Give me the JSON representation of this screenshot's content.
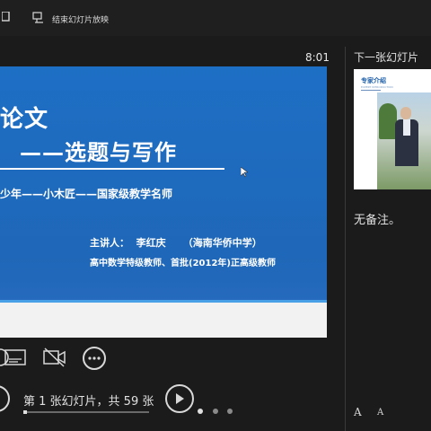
{
  "toolbar": {
    "end_show_label": "结束幻灯片放映"
  },
  "timer": "8:01",
  "slide": {
    "title_line1": "论文",
    "title_line2": "——选题与写作",
    "subtitle": "少年——小木匠——国家级教学名师",
    "speaker": "主讲人：  李红庆     （海南华侨中学）",
    "credentials": "高中数学特级教师、首批(2012年)正高级教师"
  },
  "navigation": {
    "counter": "第 1 张幻灯片，共 59 张",
    "current_slide": 1,
    "total_slides": 59
  },
  "right_pane": {
    "next_slide_label": "下一张幻灯片",
    "next_thumbnail": {
      "title": "专家介绍",
      "subtitle": "EXPERT INTRODUCTION"
    },
    "notes": "无备注。",
    "font_increase": "A",
    "font_decrease": "A"
  },
  "colors": {
    "background": "#1b1b1b",
    "slide_blue": "#1f6bbf",
    "accent_white": "#ffffff"
  }
}
